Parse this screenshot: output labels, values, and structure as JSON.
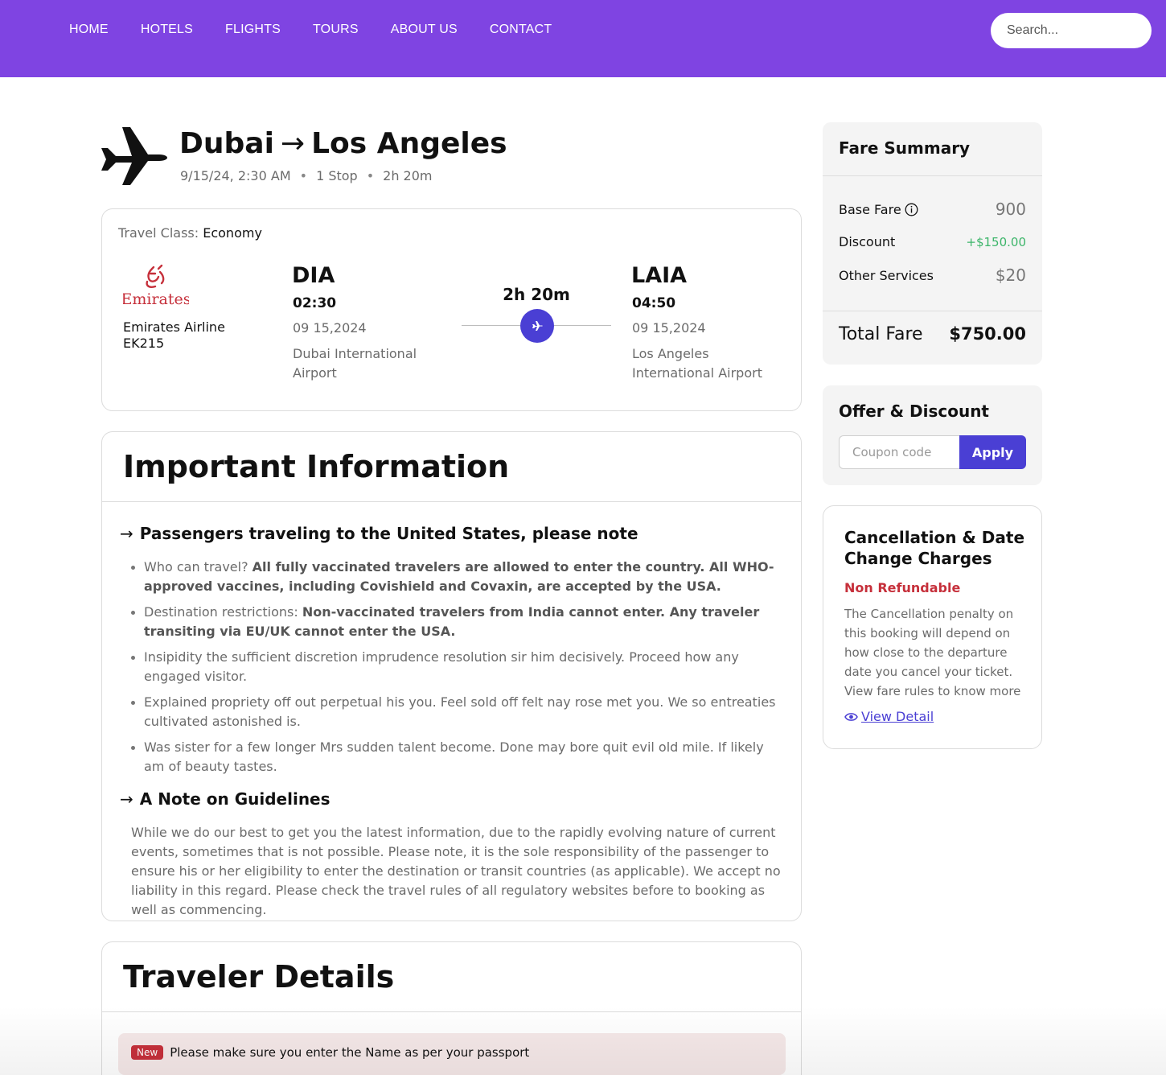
{
  "nav": {
    "items": [
      "HOME",
      "HOTELS",
      "FLIGHTS",
      "TOURS",
      "ABOUT US",
      "CONTACT"
    ],
    "search_placeholder": "Search..."
  },
  "route": {
    "icon": "airplane-icon",
    "from_city": "Dubai",
    "arrow": "→",
    "to_city": "Los Angeles",
    "datetime": "9/15/24, 2:30 AM",
    "stops": "1 Stop",
    "duration": "2h 20m",
    "separator": "•"
  },
  "flight": {
    "travel_class_label": "Travel Class:",
    "travel_class": "Economy",
    "airline_logo_text": "Emirates",
    "airline_name": "Emirates Airline",
    "flight_number": "EK215",
    "departure": {
      "code": "DIA",
      "time": "02:30",
      "date": "09 15,2024",
      "airport": "Dubai International Airport"
    },
    "duration": "2h 20m",
    "arrival": {
      "code": "LAIA",
      "time": "04:50",
      "date": "09 15,2024",
      "airport": "Los Angeles International Airport"
    }
  },
  "info": {
    "title": "Important Information",
    "section1_title": "Passengers traveling to the United States, please note",
    "bullets": [
      {
        "label": "Who can travel?",
        "bold": "All fully vaccinated travelers are allowed to enter the country. All WHO-approved vaccines, including Covishield and Covaxin, are accepted by the USA."
      },
      {
        "label": "Destination restrictions:",
        "bold": "Non-vaccinated travelers from India cannot enter. Any traveler transiting via EU/UK cannot enter the USA."
      },
      {
        "label": "Insipidity the sufficient discretion imprudence resolution sir him decisively. Proceed how any engaged visitor.",
        "bold": ""
      },
      {
        "label": "Explained propriety off out perpetual his you. Feel sold off felt nay rose met you. We so entreaties cultivated astonished is.",
        "bold": ""
      },
      {
        "label": "Was sister for a few longer Mrs sudden talent become. Done may bore quit evil old mile. If likely am of beauty tastes.",
        "bold": ""
      }
    ],
    "section2_title": "A Note on Guidelines",
    "note": "While we do our best to get you the latest information, due to the rapidly evolving nature of current events, sometimes that is not possible. Please note, it is the sole responsibility of the passenger to ensure his or her eligibility to enter the destination or transit countries (as applicable). We accept no liability in this regard. Please check the travel rules of all regulatory websites before to booking as well as commencing."
  },
  "traveler": {
    "title": "Traveler Details",
    "badge": "New",
    "notice": "Please make sure you enter the Name as per your passport"
  },
  "fare": {
    "title": "Fare Summary",
    "base_label": "Base Fare",
    "base_value": "900",
    "discount_label": "Discount",
    "discount_value": "+$150.00",
    "other_label": "Other Services",
    "other_value": "$20",
    "total_label": "Total Fare",
    "total_value": "$750.00"
  },
  "offer": {
    "title": "Offer & Discount",
    "coupon_placeholder": "Coupon code",
    "apply_label": "Apply"
  },
  "cancellation": {
    "title": "Cancellation & Date Change Charges",
    "status": "Non Refundable",
    "text": "The Cancellation penalty on this booking will depend on how close to the departure date you cancel your ticket. View fare rules to know more",
    "link_label": "View Detail"
  },
  "colors": {
    "header_bg": "#7f44e2",
    "accent": "#4a3fd4",
    "danger": "#c6303b",
    "success": "#3db56a"
  }
}
